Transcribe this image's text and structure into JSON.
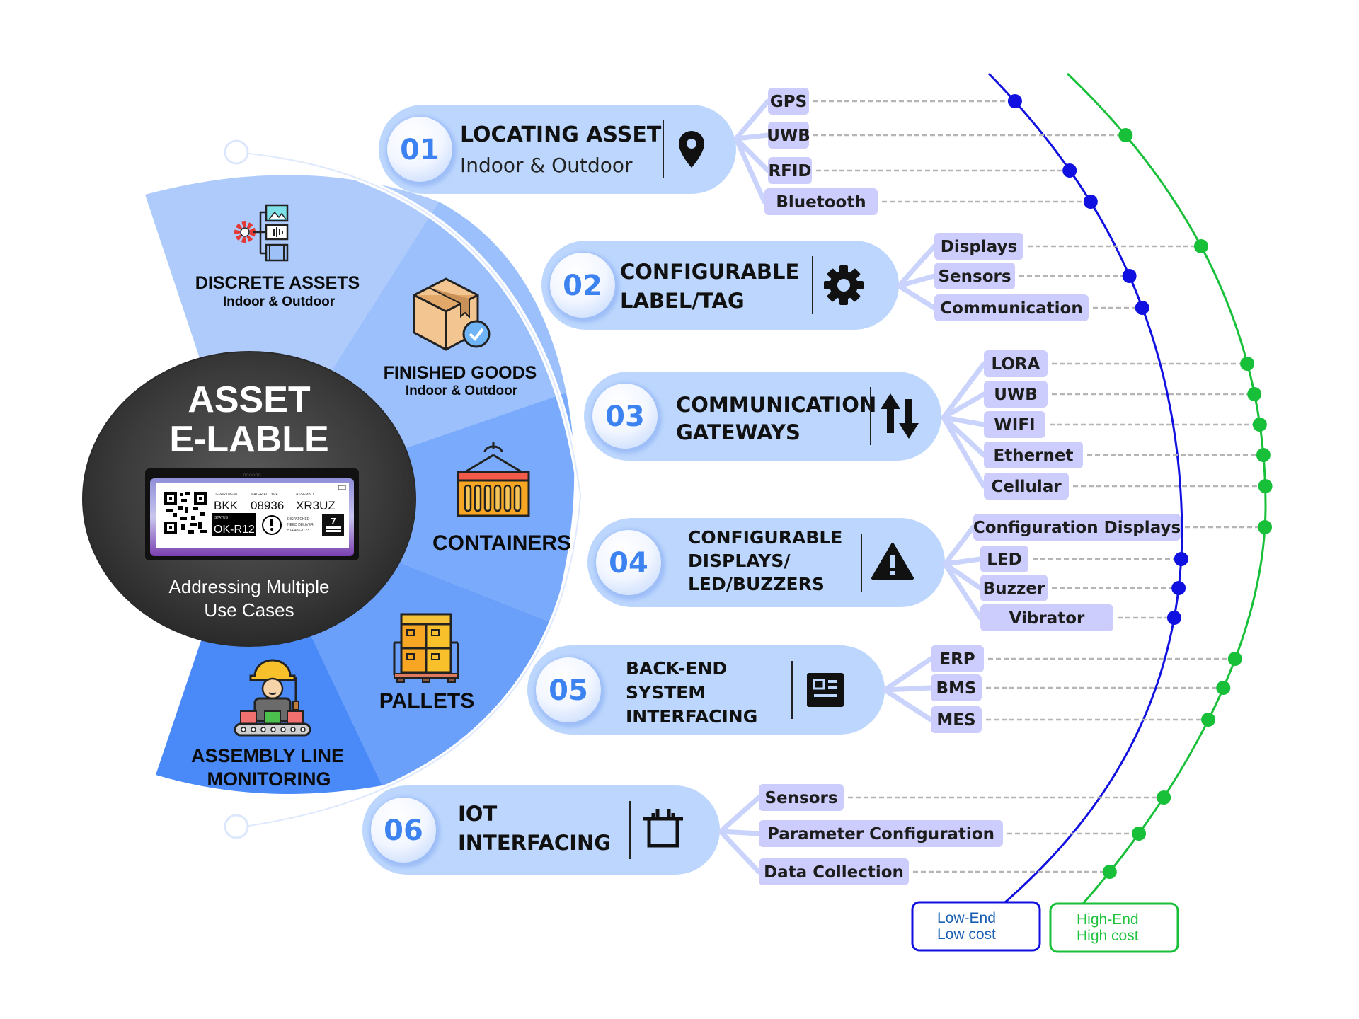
{
  "center": {
    "title_line1": "ASSET",
    "title_line2": "E-LABLE",
    "subtitle_line1": "Addressing Multiple",
    "subtitle_line2": "Use Cases",
    "label_screen": {
      "col1_header": "DEPARTMENT",
      "col1_value": "BKK",
      "col2_header": "MATERIAL TYPE",
      "col2_value": "08936",
      "col3_header": "ASSEMBLY",
      "col3_value": "XR3UZ",
      "status_header": "STATUS",
      "status_value": "OK-R12",
      "dispatch_line1": "DISPATCHED",
      "dispatch_line2": "NEED DELIVER",
      "dispatch_line3": "514-486-1123",
      "counter_value": "7"
    }
  },
  "segments": [
    {
      "id": "discrete",
      "title": "DISCRETE ASSETS",
      "subtitle": "Indoor & Outdoor",
      "icon": "media-gear-icon"
    },
    {
      "id": "finished",
      "title": "FINISHED GOODS",
      "subtitle": "Indoor & Outdoor",
      "icon": "box-check-icon"
    },
    {
      "id": "containers",
      "title": "CONTAINERS",
      "subtitle": "",
      "icon": "container-icon"
    },
    {
      "id": "pallets",
      "title": "PALLETS",
      "subtitle": "",
      "icon": "pallet-icon"
    },
    {
      "id": "assembly",
      "title_line1": "ASSEMBLY LINE",
      "title_line2": "MONITORING",
      "icon": "worker-conveyor-icon"
    }
  ],
  "features": [
    {
      "num": "01",
      "lines": [
        "LOCATING ASSET"
      ],
      "sub": "Indoor & Outdoor",
      "icon": "location-pin-icon",
      "tags": [
        "GPS",
        "UWB",
        "RFID",
        "Bluetooth"
      ],
      "tiers": [
        "low",
        "high",
        "low",
        "low"
      ]
    },
    {
      "num": "02",
      "lines": [
        "CONFIGURABLE",
        "LABEL/TAG"
      ],
      "sub": "",
      "icon": "gear-icon",
      "tags": [
        "Displays",
        "Sensors",
        "Communication"
      ],
      "tiers": [
        "high",
        "low",
        "low"
      ]
    },
    {
      "num": "03",
      "lines": [
        "COMMUNICATION",
        "GATEWAYS"
      ],
      "sub": "",
      "icon": "up-down-arrows-icon",
      "tags": [
        "LORA",
        "UWB",
        "WIFI",
        "Ethernet",
        "Cellular"
      ],
      "tiers": [
        "high",
        "high",
        "high",
        "high",
        "high"
      ]
    },
    {
      "num": "04",
      "lines": [
        "CONFIGURABLE",
        "DISPLAYS/",
        "LED/BUZZERS"
      ],
      "sub": "",
      "icon": "warning-icon",
      "tags": [
        "Configuration Displays",
        "LED",
        "Buzzer",
        "Vibrator"
      ],
      "tiers": [
        "high",
        "low",
        "low",
        "low"
      ]
    },
    {
      "num": "05",
      "lines": [
        "BACK-END",
        "SYSTEM",
        "INTERFACING"
      ],
      "sub": "",
      "icon": "dashboard-icon",
      "tags": [
        "ERP",
        "BMS",
        "MES"
      ],
      "tiers": [
        "high",
        "high",
        "high"
      ]
    },
    {
      "num": "06",
      "lines": [
        "IOT",
        "INTERFACING"
      ],
      "sub": "",
      "icon": "plug-socket-icon",
      "tags": [
        "Sensors",
        "Parameter Configuration",
        "Data Collection"
      ],
      "tiers": [
        "high",
        "high",
        "high"
      ]
    }
  ],
  "legend": {
    "low": {
      "line1": "Low-End",
      "line2": "Low cost",
      "color": "#1010e0",
      "text_color": "#1a5fb4"
    },
    "high": {
      "line1": "High-End",
      "line2": "High cost",
      "color": "#18c03a",
      "text_color": "#1ec23c"
    }
  },
  "colors": {
    "pill_bg": "#bcd6fd",
    "tag_bg": "#cdcdfd",
    "number_color": "#3c82f0",
    "segment_light": "#aecbfc",
    "segment_mid": "#8fb8fb",
    "segment_dark": "#4f8ef8",
    "center_disc": "#3a3a3a"
  }
}
